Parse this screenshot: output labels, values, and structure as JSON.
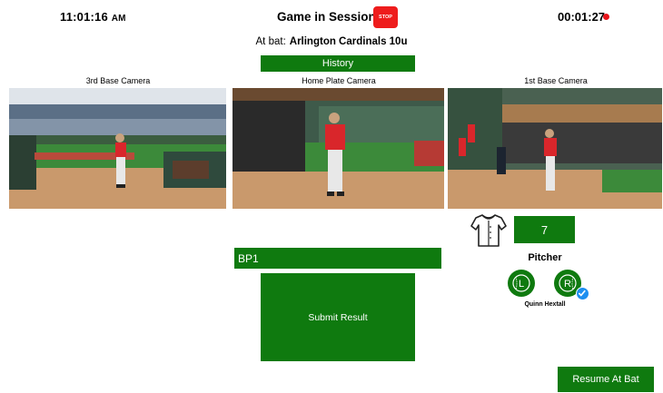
{
  "header": {
    "clock_time": "11:01:16",
    "clock_ampm": "AM",
    "title": "Game in Session",
    "stop_label": "STOP",
    "timer": "00:01:27"
  },
  "at_bat": {
    "label": "At bat:",
    "team": "Arlington Cardinals 10u"
  },
  "history_label": "History",
  "cameras": [
    {
      "label": "3rd Base Camera"
    },
    {
      "label": "Home Plate Camera"
    },
    {
      "label": "1st Base Camera"
    }
  ],
  "pitcher_panel": {
    "jersey_number": "7",
    "label": "Pitcher",
    "left_hand": "L",
    "right_hand": "R",
    "name": "Quinn Hextall"
  },
  "result_input": {
    "value": "BP1"
  },
  "submit_label": "Submit Result",
  "resume_label": "Resume At Bat",
  "colors": {
    "primary_green": "#0f7a0f",
    "stop_red": "#ee1c1c",
    "record_dot": "#e8141a",
    "check_blue": "#1e8ff0"
  },
  "icons": [
    "jersey-icon",
    "left-hand-icon",
    "right-hand-icon",
    "checkmark-icon",
    "record-dot-icon"
  ]
}
